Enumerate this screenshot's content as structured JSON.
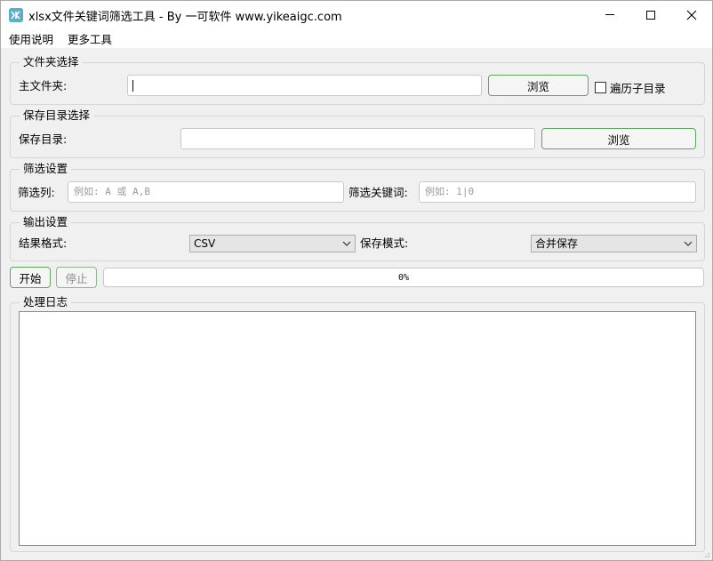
{
  "window": {
    "title": "xlsx文件关键词筛选工具 - By 一可软件 www.yikeaigc.com",
    "icon_text": "YK"
  },
  "menu": {
    "items": [
      {
        "label": "使用说明"
      },
      {
        "label": "更多工具"
      }
    ]
  },
  "folder_group": {
    "title": "文件夹选择",
    "main_folder_label": "主文件夹:",
    "main_folder_value": "",
    "browse_label": "浏览",
    "traverse_label": "遍历子目录",
    "traverse_checked": false
  },
  "save_group": {
    "title": "保存目录选择",
    "save_dir_label": "保存目录:",
    "save_dir_value": "",
    "browse_label": "浏览"
  },
  "filter_group": {
    "title": "筛选设置",
    "column_label": "筛选列:",
    "column_placeholder": "例如: A 或 A,B",
    "keyword_label": "筛选关键词:",
    "keyword_placeholder": "例如: 1|0"
  },
  "output_group": {
    "title": "输出设置",
    "format_label": "结果格式:",
    "format_value": "CSV",
    "mode_label": "保存模式:",
    "mode_value": "合并保存"
  },
  "controls": {
    "start_label": "开始",
    "stop_label": "停止",
    "progress_text": "0%",
    "progress_value": 0
  },
  "log_group": {
    "title": "处理日志",
    "content": ""
  }
}
